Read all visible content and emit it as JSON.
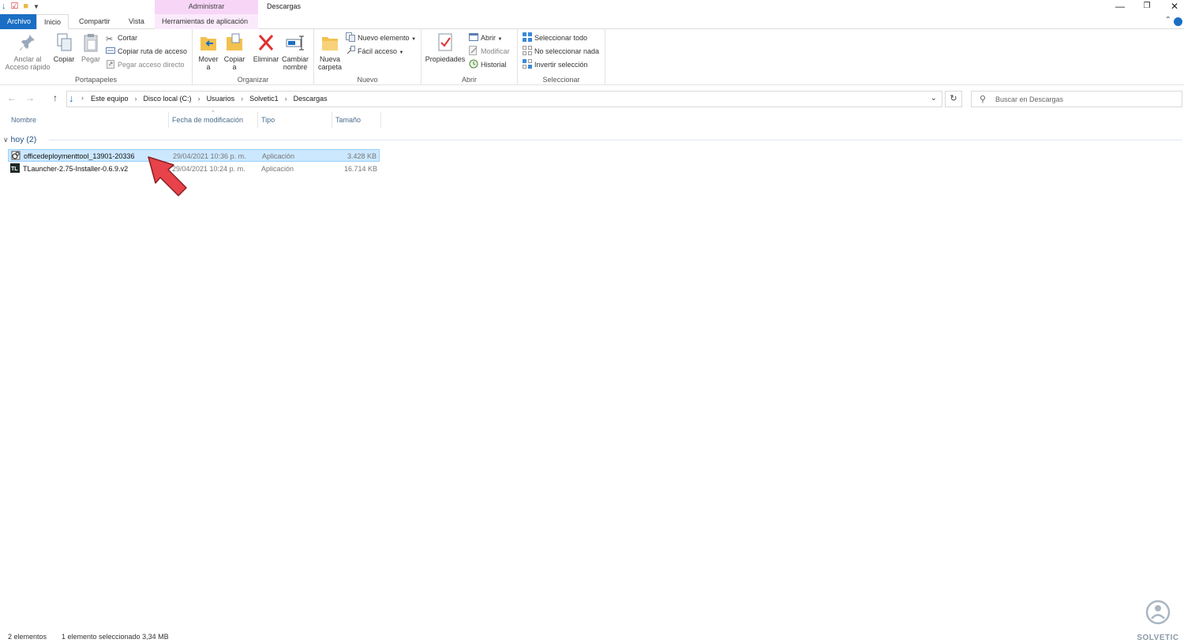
{
  "window": {
    "title": "Descargas",
    "context_tab_title": "Administrar"
  },
  "tabs": {
    "file": "Archivo",
    "home": "Inicio",
    "share": "Compartir",
    "view": "Vista",
    "app_tools": "Herramientas de aplicación"
  },
  "ribbon": {
    "clipboard": {
      "label": "Portapapeles",
      "pin": "Anclar al Acceso rápido",
      "copy": "Copiar",
      "paste": "Pegar",
      "cut": "Cortar",
      "copy_path": "Copiar ruta de acceso",
      "paste_shortcut": "Pegar acceso directo"
    },
    "organize": {
      "label": "Organizar",
      "move_to": "Mover a",
      "copy_to": "Copiar a",
      "delete": "Eliminar",
      "rename": "Cambiar nombre"
    },
    "new": {
      "label": "Nuevo",
      "new_folder": "Nueva carpeta",
      "new_item": "Nuevo elemento",
      "easy_access": "Fácil acceso"
    },
    "open": {
      "label": "Abrir",
      "properties": "Propiedades",
      "open": "Abrir",
      "edit": "Modificar",
      "history": "Historial"
    },
    "select": {
      "label": "Seleccionar",
      "select_all": "Seleccionar todo",
      "select_none": "No seleccionar nada",
      "invert": "Invertir selección"
    }
  },
  "address": {
    "crumbs": [
      "Este equipo",
      "Disco local (C:)",
      "Usuarios",
      "Solvetic1",
      "Descargas"
    ],
    "search_placeholder": "Buscar en Descargas"
  },
  "columns": {
    "name": "Nombre",
    "date": "Fecha de modificación",
    "type": "Tipo",
    "size": "Tamaño"
  },
  "group": {
    "label": "hoy (2)"
  },
  "files": [
    {
      "name": "officedeploymenttool_13901-20336",
      "date": "29/04/2021 10:36 p. m.",
      "type": "Aplicación",
      "size": "3.428 KB",
      "icon": "installer-gear-icon",
      "selected": true
    },
    {
      "name": "TLauncher-2.75-Installer-0.6.9.v2",
      "date": "29/04/2021 10:24 p. m.",
      "type": "Aplicación",
      "size": "16.714 KB",
      "icon": "tlauncher-icon",
      "selected": false
    }
  ],
  "status": {
    "count": "2 elementos",
    "selection": "1 elemento seleccionado  3,34 MB"
  },
  "watermark": {
    "text": "SOLVETIC"
  },
  "colors": {
    "accent": "#1a6fc4",
    "selection_bg": "#cce8ff",
    "selection_border": "#99d1ff",
    "context_tab": "#f7d5f7",
    "pointer": "#e8434a"
  }
}
